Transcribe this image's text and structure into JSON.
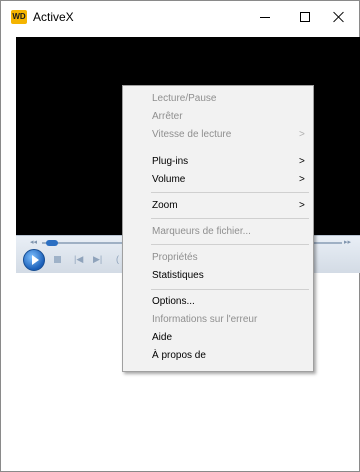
{
  "window": {
    "title": "ActiveX",
    "app_icon_text": "WD",
    "buttons": {
      "minimize": "minimize-icon",
      "maximize": "maximize-icon",
      "close": "close-icon"
    }
  },
  "player": {
    "controls": {
      "play": "play-icon",
      "stop": "stop-icon",
      "previous": "previous-icon",
      "next": "next-icon",
      "seek_left": "◂◂",
      "seek_right": "▸▸",
      "prev_glyph": "|◀",
      "next_glyph": "▶|",
      "more_glyph": "("
    }
  },
  "context_menu": {
    "items": [
      {
        "label": "Lecture/Pause",
        "enabled": false,
        "submenu": false
      },
      {
        "label": "Arrêter",
        "enabled": false,
        "submenu": false
      },
      {
        "label": "Vitesse de lecture",
        "enabled": false,
        "submenu": true
      },
      {
        "label": "Plug-ins",
        "enabled": true,
        "submenu": true
      },
      {
        "label": "Volume",
        "enabled": true,
        "submenu": true
      },
      {
        "label": "Zoom",
        "enabled": true,
        "submenu": true
      },
      {
        "label": "Marqueurs de fichier...",
        "enabled": false,
        "submenu": false
      },
      {
        "label": "Propriétés",
        "enabled": false,
        "submenu": false
      },
      {
        "label": "Statistiques",
        "enabled": true,
        "submenu": false
      },
      {
        "label": "Options...",
        "enabled": true,
        "submenu": false
      },
      {
        "label": "Informations sur l'erreur",
        "enabled": false,
        "submenu": false
      },
      {
        "label": "Aide",
        "enabled": true,
        "submenu": false
      },
      {
        "label": "À propos de",
        "enabled": true,
        "submenu": false
      }
    ],
    "submenu_arrow": ">"
  }
}
